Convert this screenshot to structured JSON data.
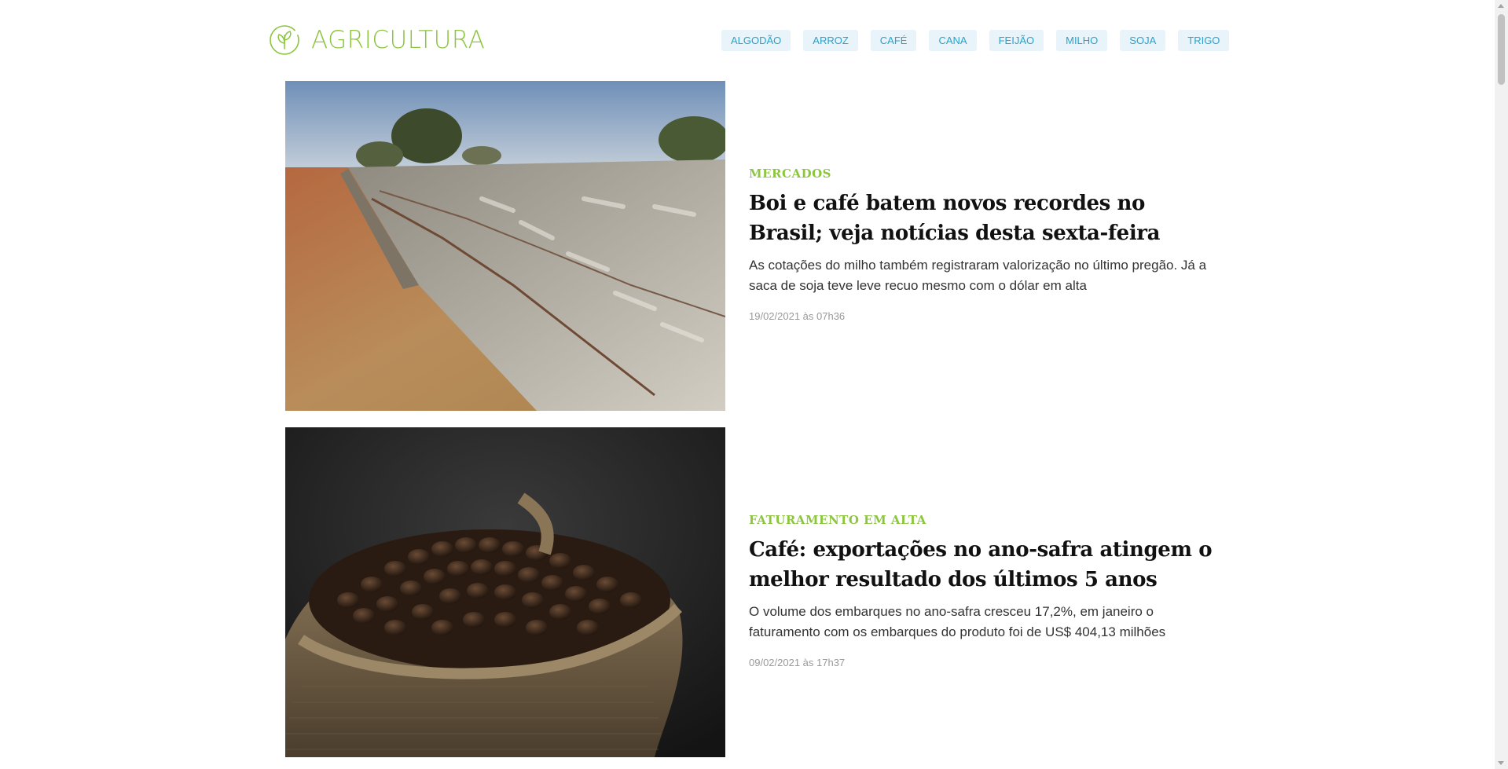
{
  "header": {
    "logo_text": "AGRICULTURA",
    "logo_icon": "leaf-circle-icon",
    "nav": [
      {
        "label": "ALGODÃO"
      },
      {
        "label": "ARROZ"
      },
      {
        "label": "CAFÉ"
      },
      {
        "label": "CANA"
      },
      {
        "label": "FEIJÃO"
      },
      {
        "label": "MILHO"
      },
      {
        "label": "SOJA"
      },
      {
        "label": "TRIGO"
      }
    ]
  },
  "articles": [
    {
      "kicker": "MERCADOS",
      "headline": "Boi e café batem novos recordes no Brasil; veja notícias desta sexta-feira",
      "summary": "As cotações do milho também registraram valorização no último pregão. Já a saca de soja teve leve recuo mesmo com o dólar em alta",
      "date": "19/02/2021 às 07h36",
      "image": "cattle-feedlot-photo"
    },
    {
      "kicker": "FATURAMENTO EM ALTA",
      "headline": "Café: exportações no ano-safra atingem o melhor resultado dos últimos 5 anos",
      "summary": "O volume dos embarques no ano-safra cresceu 17,2%, em janeiro o faturamento com os embarques do produto foi de US$ 404,13 milhões",
      "date": "09/02/2021 às 17h37",
      "image": "coffee-beans-sack-photo"
    }
  ],
  "colors": {
    "brand_green": "#8cc63f",
    "nav_text": "#2aa2cc",
    "nav_bg": "#e8f4fa",
    "headline": "#111111",
    "date": "#999999"
  }
}
